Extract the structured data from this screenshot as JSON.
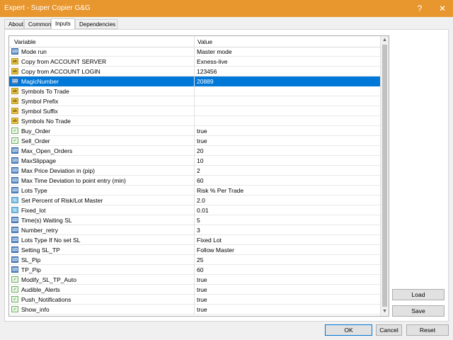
{
  "window": {
    "title": "Expert - Super Copier G&G",
    "help": "?",
    "close": "✕"
  },
  "tabs": [
    {
      "label": "About"
    },
    {
      "label": "Common"
    },
    {
      "label": "Inputs"
    },
    {
      "label": "Dependencies"
    }
  ],
  "active_tab": "Inputs",
  "grid": {
    "headers": {
      "variable": "Variable",
      "value": "Value"
    },
    "rows": [
      {
        "type": "num",
        "name": "Mode run",
        "value": "Master mode"
      },
      {
        "type": "txt",
        "name": "Copy from ACCOUNT SERVER",
        "value": "Exness-live"
      },
      {
        "type": "txt",
        "name": "Copy from ACCOUNT LOGIN",
        "value": "123456"
      },
      {
        "type": "num",
        "name": "MagicNumber",
        "value": "20889",
        "selected": true
      },
      {
        "type": "txt",
        "name": "Symbols To Trade",
        "value": ""
      },
      {
        "type": "txt",
        "name": "Symbol Prefix",
        "value": ""
      },
      {
        "type": "txt",
        "name": "Symbol Suffix",
        "value": ""
      },
      {
        "type": "txt",
        "name": "Symbols No Trade",
        "value": ""
      },
      {
        "type": "bool",
        "name": "Buy_Order",
        "value": "true"
      },
      {
        "type": "bool",
        "name": "Sell_Order",
        "value": "true"
      },
      {
        "type": "num",
        "name": "Max_Open_Orders",
        "value": "20"
      },
      {
        "type": "num",
        "name": "MaxSlippage",
        "value": "10"
      },
      {
        "type": "num",
        "name": "Max Price Deviation in (pip)",
        "value": "2"
      },
      {
        "type": "num",
        "name": "Max Time Deviation to point entry (min)",
        "value": "60"
      },
      {
        "type": "num",
        "name": "Lots Type",
        "value": "Risk % Per Trade"
      },
      {
        "type": "dbl",
        "name": "Set Percent of Risk/Lot Master",
        "value": "2.0"
      },
      {
        "type": "dbl",
        "name": "Fixed_lot",
        "value": "0.01"
      },
      {
        "type": "num",
        "name": "Time(s) Waiting SL",
        "value": "5"
      },
      {
        "type": "num",
        "name": "Number_retry",
        "value": "3"
      },
      {
        "type": "num",
        "name": "Lots Type If No set SL",
        "value": "Fixed Lot"
      },
      {
        "type": "num",
        "name": "Setting SL_TP",
        "value": "Follow Master"
      },
      {
        "type": "num",
        "name": "SL_Pip",
        "value": "25"
      },
      {
        "type": "num",
        "name": "TP_Pip",
        "value": "60"
      },
      {
        "type": "bool",
        "name": "Modify_SL_TP_Auto",
        "value": "true"
      },
      {
        "type": "bool",
        "name": "Audible_Alerts",
        "value": "true"
      },
      {
        "type": "bool",
        "name": "Push_Notifications",
        "value": "true"
      },
      {
        "type": "bool",
        "name": "Show_info",
        "value": "true"
      }
    ]
  },
  "icon_glyphs": {
    "num": "123",
    "txt": "ab",
    "bool": "✓",
    "dbl": "½"
  },
  "buttons": {
    "load": "Load",
    "save": "Save",
    "ok": "OK",
    "cancel": "Cancel",
    "reset": "Reset"
  },
  "colors": {
    "titlebar": "#e8962e",
    "selection": "#0078d7"
  }
}
